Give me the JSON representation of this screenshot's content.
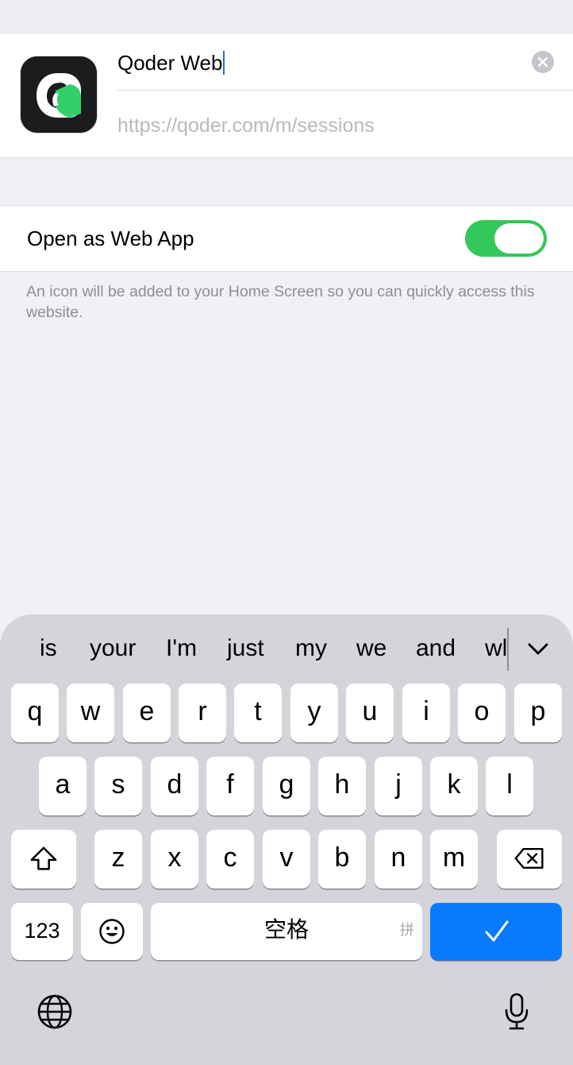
{
  "app": {
    "name": "Qoder Web",
    "url": "https://qoder.com/m/sessions"
  },
  "web_app": {
    "label": "Open as Web App",
    "enabled": true,
    "hint": "An icon will be added to your Home Screen so you can quickly access this website."
  },
  "colors": {
    "toggle_on": "#34c759",
    "caret": "#1f6fe0",
    "return_key": "#0a7aff",
    "icon_accent": "#32d06b"
  },
  "keyboard": {
    "suggestions": [
      "is",
      "your",
      "I'm",
      "just",
      "my",
      "we",
      "and",
      "wl"
    ],
    "rows": [
      [
        "q",
        "w",
        "e",
        "r",
        "t",
        "y",
        "u",
        "i",
        "o",
        "p"
      ],
      [
        "a",
        "s",
        "d",
        "f",
        "g",
        "h",
        "j",
        "k",
        "l"
      ],
      [
        "z",
        "x",
        "c",
        "v",
        "b",
        "n",
        "m"
      ]
    ],
    "numbers_key": "123",
    "space_label": "空格",
    "space_sub": "拼",
    "icons": {
      "shift": "shift-icon",
      "delete": "delete-icon",
      "emoji": "emoji-icon",
      "return": "checkmark-icon",
      "globe": "globe-icon",
      "mic": "microphone-icon",
      "chevron": "chevron-down-icon",
      "clear": "clear-icon"
    }
  }
}
